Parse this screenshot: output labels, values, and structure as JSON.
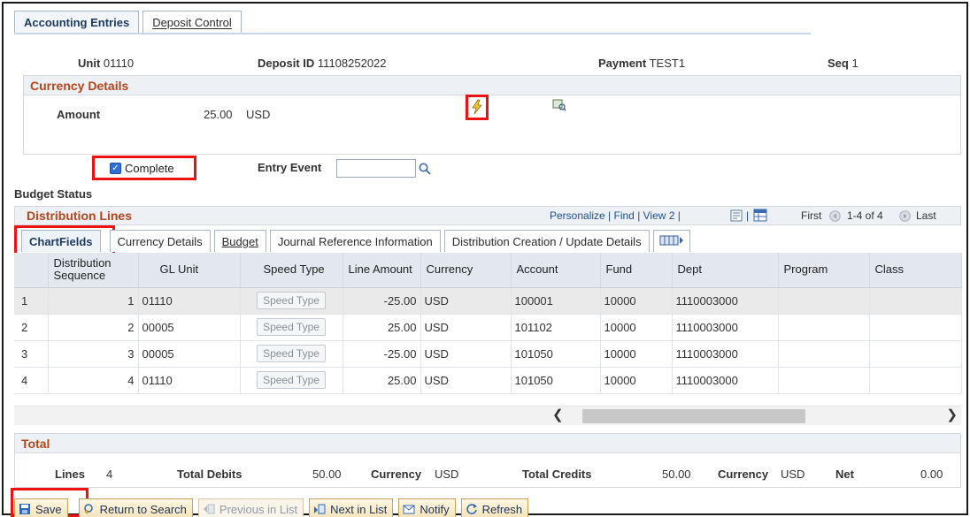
{
  "page_tabs": [
    {
      "label": "Accounting Entries",
      "active": true
    },
    {
      "label": "Deposit Control",
      "active": false
    }
  ],
  "header": {
    "unit_label": "Unit",
    "unit_value": "01110",
    "deposit_id_label": "Deposit ID",
    "deposit_id_value": "11108252022",
    "payment_label": "Payment",
    "payment_value": "TEST1",
    "seq_label": "Seq",
    "seq_value": "1"
  },
  "currency_details": {
    "title": "Currency Details",
    "amount_label": "Amount",
    "amount_value": "25.00",
    "currency": "USD"
  },
  "complete": {
    "label": "Complete",
    "checked": true
  },
  "entry_event": {
    "label": "Entry Event",
    "value": ""
  },
  "budget_status_label": "Budget Status",
  "distribution": {
    "title": "Distribution Lines",
    "personalize": "Personalize",
    "find": "Find",
    "view2": "View 2",
    "first": "First",
    "range": "1-4 of 4",
    "last": "Last",
    "tabs": [
      {
        "label": "ChartFields",
        "active": true
      },
      {
        "label": "Currency Details",
        "active": false
      },
      {
        "label": "Budget",
        "active": false
      },
      {
        "label": "Journal Reference Information",
        "active": false
      },
      {
        "label": "Distribution Creation / Update Details",
        "active": false
      }
    ],
    "columns": [
      "",
      "Distribution Sequence",
      "GL Unit",
      "Speed Type",
      "Line Amount",
      "Currency",
      "Account",
      "Fund",
      "Dept",
      "Program",
      "Class"
    ],
    "speed_type_label": "Speed Type",
    "rows": [
      {
        "n": "1",
        "seq": "1",
        "gl_unit": "01110",
        "line_amount": "-25.00",
        "currency": "USD",
        "account": "100001",
        "fund": "10000",
        "dept": "1110003000",
        "program": "",
        "class": ""
      },
      {
        "n": "2",
        "seq": "2",
        "gl_unit": "00005",
        "line_amount": "25.00",
        "currency": "USD",
        "account": "101102",
        "fund": "10000",
        "dept": "1110003000",
        "program": "",
        "class": ""
      },
      {
        "n": "3",
        "seq": "3",
        "gl_unit": "00005",
        "line_amount": "-25.00",
        "currency": "USD",
        "account": "101050",
        "fund": "10000",
        "dept": "1110003000",
        "program": "",
        "class": ""
      },
      {
        "n": "4",
        "seq": "4",
        "gl_unit": "01110",
        "line_amount": "25.00",
        "currency": "USD",
        "account": "101050",
        "fund": "10000",
        "dept": "1110003000",
        "program": "",
        "class": ""
      }
    ]
  },
  "total": {
    "title": "Total",
    "lines_label": "Lines",
    "lines_value": "4",
    "total_debits_label": "Total Debits",
    "total_debits_value": "50.00",
    "currency_label": "Currency",
    "currency_value": "USD",
    "total_credits_label": "Total Credits",
    "total_credits_value": "50.00",
    "currency2_label": "Currency",
    "currency2_value": "USD",
    "net_label": "Net",
    "net_value": "0.00"
  },
  "toolbar": {
    "save": "Save",
    "return_to_search": "Return to Search",
    "previous_in_list": "Previous in List",
    "next_in_list": "Next in List",
    "notify": "Notify",
    "refresh": "Refresh"
  },
  "colors": {
    "section_title": "#b3461b",
    "highlight": "#ee1111",
    "link": "#1f4f8e"
  }
}
